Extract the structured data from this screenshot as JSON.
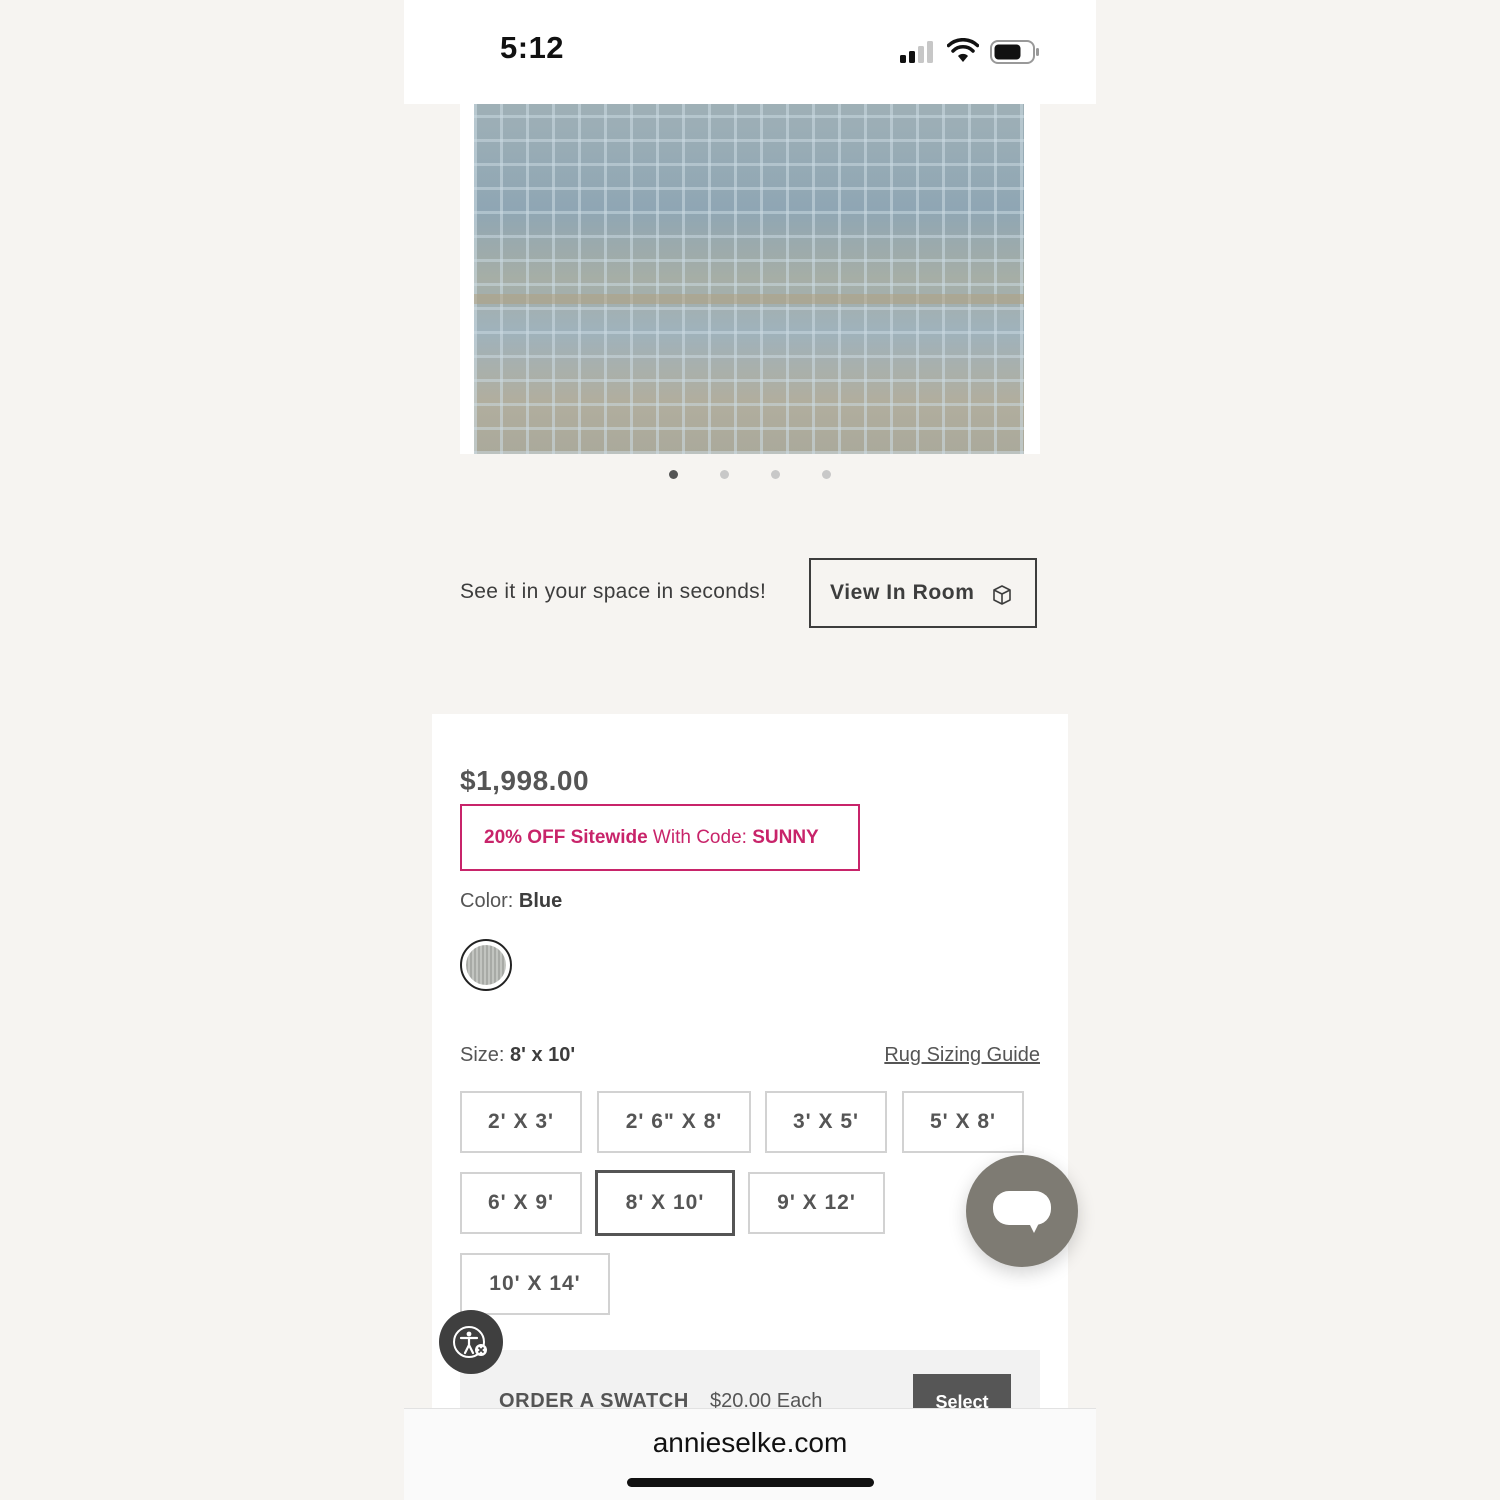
{
  "status_bar": {
    "time": "5:12"
  },
  "gallery": {
    "slide_count": 4,
    "active_index": 0
  },
  "view_in_room": {
    "tagline": "See it in your space in seconds!",
    "button_label": "View In Room"
  },
  "product": {
    "price": "$1,998.00",
    "promo": {
      "part1": "20% OFF Sitewide",
      "part2": " With Code: ",
      "code": "SUNNY"
    },
    "color": {
      "label": "Color: ",
      "value": "Blue"
    },
    "size": {
      "label": "Size: ",
      "value": "8' x 10'"
    },
    "sizing_guide_link": "Rug Sizing Guide",
    "sizes": [
      "2' X 3'",
      "2' 6\" X 8'",
      "3' X 5'",
      "5' X 8'",
      "6' X 9'",
      "8' X 10'",
      "9' X 12'",
      "10' X 14'"
    ],
    "selected_size_index": 5,
    "swatch_order": {
      "label": "ORDER A SWATCH",
      "price": "$20.00 Each",
      "button_label": "Select"
    }
  },
  "browser": {
    "domain": "annieselke.com"
  },
  "colors": {
    "promo": "#c8246a",
    "chat_button": "#7e7b73",
    "select_button": "#565656"
  }
}
